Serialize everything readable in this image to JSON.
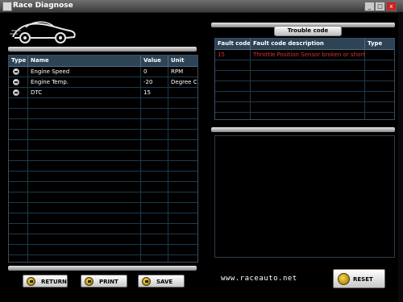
{
  "window": {
    "title": "Race Diagnose",
    "controls": {
      "minimize": "_",
      "maximize": "□",
      "close": "x"
    }
  },
  "logo": {
    "icon": "car-logo-icon"
  },
  "left_table": {
    "columns": [
      "Type",
      "Name",
      "Value",
      "Unit"
    ],
    "rows": [
      {
        "icon": "gauge-icon",
        "name": "Engine Speed",
        "value": "0",
        "unit": "RPM"
      },
      {
        "icon": "gauge-icon",
        "name": "Engine Temp.",
        "value": "-20",
        "unit": "Degree C"
      },
      {
        "icon": "gauge-icon",
        "name": "DTC",
        "value": "15",
        "unit": ""
      }
    ]
  },
  "trouble_code": {
    "tab_label": "Trouble code",
    "columns": [
      "Fault code",
      "Fault code description",
      "Type"
    ],
    "rows": [
      {
        "code": "15",
        "description": "Throttle Position Sensor broken or short c...",
        "type": ""
      }
    ]
  },
  "buttons": {
    "return_label": "RETURN",
    "print_label": "PRINT",
    "save_label": "SAVE",
    "reset_label": "RESET"
  },
  "footer": {
    "url": "www.raceauto.net"
  },
  "colors": {
    "header_bg": "#2d4356",
    "grid_line": "#1d3a4a",
    "fault_text": "#e03030"
  }
}
